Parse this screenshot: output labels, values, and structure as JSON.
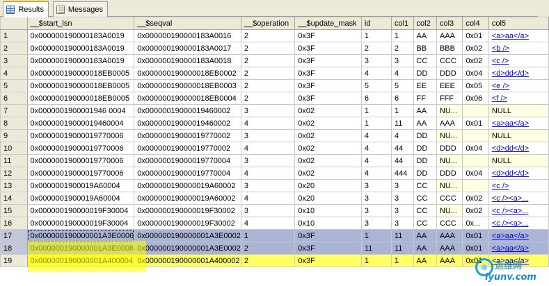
{
  "tabs": [
    {
      "label": "Results",
      "icon": "grid-icon",
      "active": true
    },
    {
      "label": "Messages",
      "icon": "messages-icon",
      "active": false
    }
  ],
  "columns": [
    "__$start_lsn",
    "__$seqval",
    "__$operation",
    "__$update_mask",
    "id",
    "col1",
    "col2",
    "col3",
    "col4",
    "col5"
  ],
  "rows": [
    {
      "n": "1",
      "cells": [
        "0x000000190000183A0019",
        "0x000000190000183A0016",
        "2",
        "0x3F",
        "1",
        "1",
        "AA",
        "AAA",
        "0x01",
        "<a>aa</a>"
      ]
    },
    {
      "n": "2",
      "cells": [
        "0x000000190000183A0019",
        "0x000000190000183A0017",
        "2",
        "0x3F",
        "2",
        "2",
        "BB",
        "BBB",
        "0x02",
        "<b />"
      ]
    },
    {
      "n": "3",
      "cells": [
        "0x000000190000183A0019",
        "0x000000190000183A0018",
        "2",
        "0x3F",
        "3",
        "3",
        "CC",
        "CCC",
        "0x02",
        "<c />"
      ]
    },
    {
      "n": "4",
      "cells": [
        "0x000000190000018EB0005",
        "0x000000190000018EB0002",
        "2",
        "0x3F",
        "4",
        "4",
        "DD",
        "DDD",
        "0x04",
        "<d>dd</d>"
      ]
    },
    {
      "n": "5",
      "cells": [
        "0x000000190000018EB0005",
        "0x000000190000018EB0003",
        "2",
        "0x3F",
        "5",
        "5",
        "EE",
        "EEE",
        "0x05",
        "<e />"
      ]
    },
    {
      "n": "6",
      "cells": [
        "0x000000190000018EB0005",
        "0x000000190000018EB0004",
        "2",
        "0x3F",
        "6",
        "6",
        "FF",
        "FFF",
        "0x06",
        "<f />"
      ]
    },
    {
      "n": "7",
      "cells": [
        "0x0000001900001946 0004",
        "0x00000019000019460002",
        "3",
        "0x02",
        "1",
        "1",
        "AA",
        "NU...",
        "",
        "NULL"
      ]
    },
    {
      "n": "8",
      "cells": [
        "0x00000019000019460004",
        "0x00000019000019460002",
        "4",
        "0x02",
        "1",
        "11",
        "AA",
        "AAA",
        "0x01",
        "<a>aa</a>"
      ]
    },
    {
      "n": "9",
      "cells": [
        "0x00000019000019770006",
        "0x00000019000019770002",
        "3",
        "0x02",
        "4",
        "4",
        "DD",
        "NU...",
        "",
        "NULL"
      ]
    },
    {
      "n": "10",
      "cells": [
        "0x00000019000019770006",
        "0x00000019000019770002",
        "4",
        "0x02",
        "4",
        "44",
        "DD",
        "DDD",
        "0x04",
        "<d>dd</d>"
      ]
    },
    {
      "n": "11",
      "cells": [
        "0x00000019000019770006",
        "0x00000019000019770004",
        "3",
        "0x02",
        "4",
        "44",
        "DD",
        "NU...",
        "",
        "NULL"
      ]
    },
    {
      "n": "12",
      "cells": [
        "0x00000019000019770006",
        "0x00000019000019770004",
        "4",
        "0x02",
        "4",
        "444",
        "DD",
        "DDD",
        "0x04",
        "<d>dd</d>"
      ]
    },
    {
      "n": "13",
      "cells": [
        "0x0000001900019A60004",
        "0x000000190000019A60002",
        "3",
        "0x20",
        "3",
        "3",
        "CC",
        "NU...",
        "",
        "<c />"
      ]
    },
    {
      "n": "14",
      "cells": [
        "0x0000001900019A60004",
        "0x000000190000019A60002",
        "4",
        "0x20",
        "3",
        "3",
        "CC",
        "CCC",
        "0x02",
        "<c /><a>..."
      ]
    },
    {
      "n": "15",
      "cells": [
        "0x000000190000019F30004",
        "0x000000190000019F30002",
        "3",
        "0x10",
        "3",
        "3",
        "CC",
        "NU...",
        "0x02",
        "<c /><a>..."
      ]
    },
    {
      "n": "16",
      "cells": [
        "0x000000190000019F30004",
        "0x000000190000019F30002",
        "4",
        "0x10",
        "3",
        "3",
        "CC",
        "CCC",
        "0x...",
        "<c /><a>..."
      ]
    },
    {
      "n": "17",
      "cells": [
        "0x000000190000001A3E0006",
        "0x000000190000001A3E0002",
        "1",
        "0x3F",
        "1",
        "11",
        "AA",
        "AAA",
        "0x01",
        "<a>aa</a>"
      ]
    },
    {
      "n": "18",
      "cells": [
        "0x000000190000001A3E0006",
        "0x000000190000001A3E0002",
        "2",
        "0x3F",
        "11",
        "11",
        "AA",
        "AAA",
        "0x01",
        "<a>aa</a>"
      ]
    },
    {
      "n": "19",
      "cells": [
        "0x000000190000001A400004",
        "0x000000190000001A400002",
        "2",
        "0x3F",
        "1",
        "1",
        "AA",
        "AAA",
        "0x01",
        "<a>aa</a>"
      ]
    }
  ],
  "watermark": {
    "top": "运维网",
    "bottom": "iyunv.com"
  }
}
